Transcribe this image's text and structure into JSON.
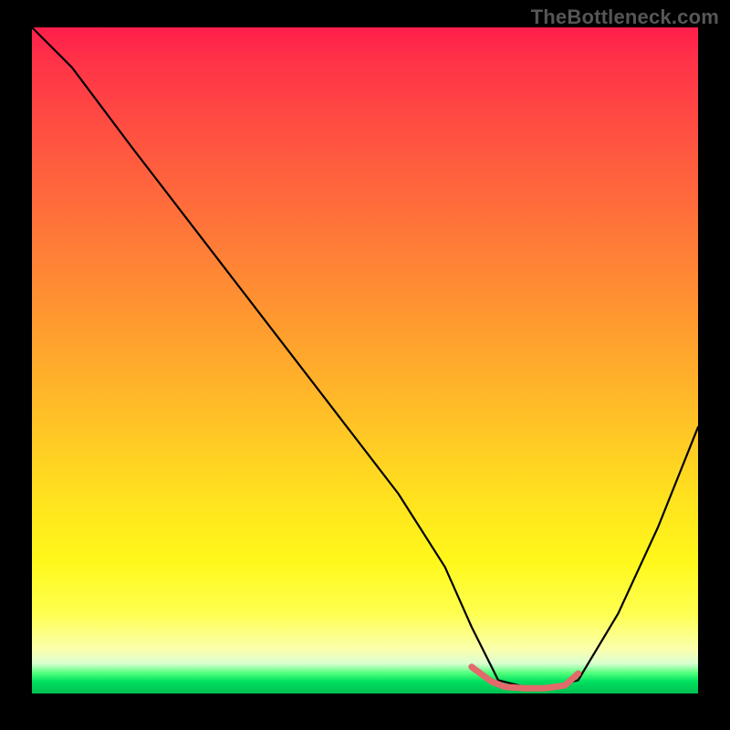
{
  "watermark": "TheBottleneck.com",
  "chart_data": {
    "type": "line",
    "title": "",
    "xlabel": "",
    "ylabel": "",
    "xlim": [
      0,
      100
    ],
    "ylim": [
      0,
      100
    ],
    "grid": false,
    "series": [
      {
        "name": "curve",
        "x": [
          0,
          6,
          15,
          25,
          35,
          45,
          55,
          62,
          66,
          70,
          74,
          78,
          82,
          88,
          94,
          100
        ],
        "values": [
          100,
          94,
          82,
          69,
          56,
          43,
          30,
          19,
          10,
          2,
          1,
          1,
          2,
          12,
          25,
          40
        ]
      }
    ],
    "marker": {
      "name": "minimum-segment",
      "color": "#e36a6a",
      "points_x": [
        66,
        69,
        71,
        74,
        77,
        80,
        82
      ],
      "points_y": [
        4,
        1.8,
        1,
        0.8,
        0.8,
        1.2,
        3
      ]
    },
    "gradient_stops": [
      {
        "pos": 0,
        "color": "#ff1e4b"
      },
      {
        "pos": 0.45,
        "color": "#ff9c2f"
      },
      {
        "pos": 0.8,
        "color": "#fff81a"
      },
      {
        "pos": 0.95,
        "color": "#d9ffd0"
      },
      {
        "pos": 1.0,
        "color": "#00c050"
      }
    ]
  }
}
